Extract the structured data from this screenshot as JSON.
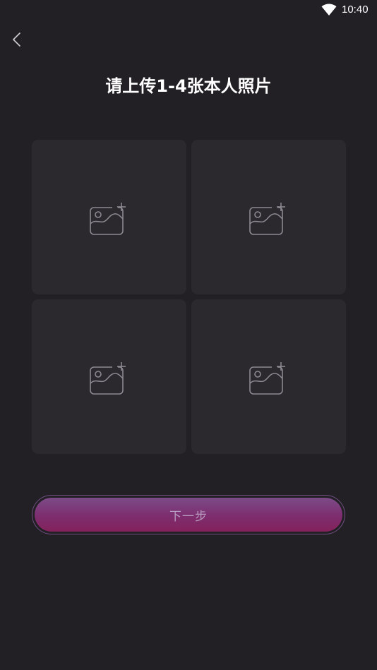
{
  "status_bar": {
    "time": "10:40",
    "wifi_icon": "wifi-icon"
  },
  "nav": {
    "back_icon": "chevron-left-icon"
  },
  "page": {
    "title": "请上传1-4张本人照片"
  },
  "photo_slots": [
    {
      "icon": "add-photo-icon"
    },
    {
      "icon": "add-photo-icon"
    },
    {
      "icon": "add-photo-icon"
    },
    {
      "icon": "add-photo-icon"
    }
  ],
  "actions": {
    "next_label": "下一步"
  },
  "colors": {
    "background": "#221f25",
    "tile": "#2b282e",
    "icon_stroke": "#8c8990",
    "button_top": "#7c4b88",
    "button_bottom": "#84225c",
    "button_text": "#b89bbf"
  }
}
